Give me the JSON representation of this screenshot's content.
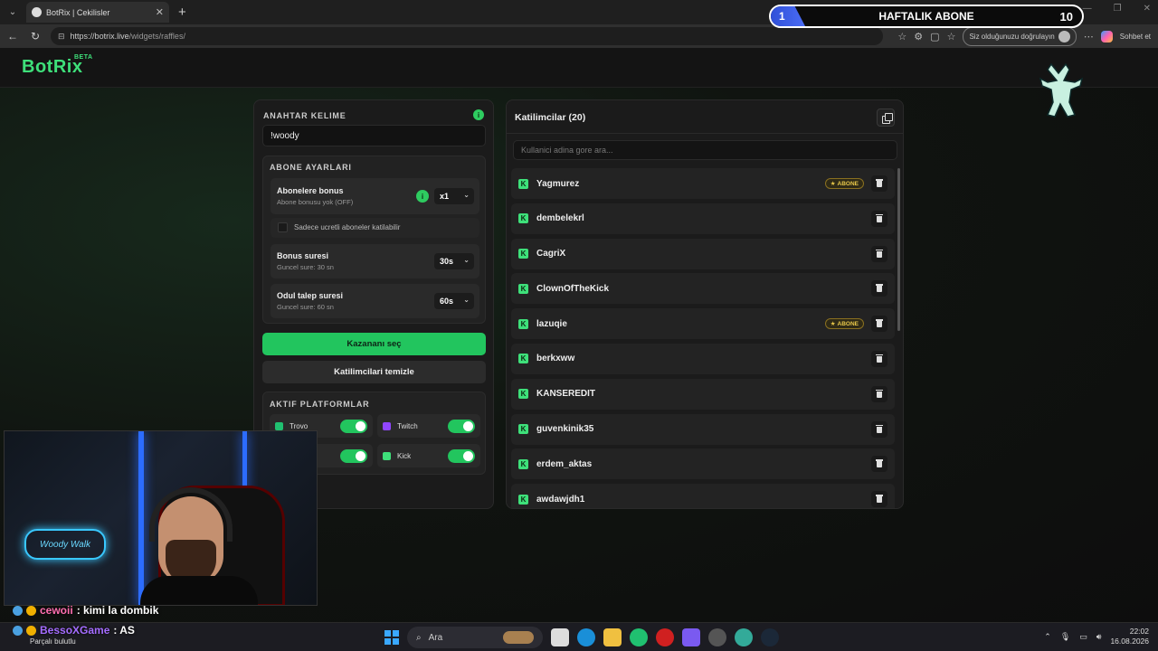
{
  "browser": {
    "tab_title": "BotRix | Cekilisler",
    "url_host": "https://botrix.live",
    "url_path": "/widgets/raffles/",
    "verify_label": "Siz olduğunuzu doğrulayın",
    "chat_label": "Sohbet et"
  },
  "sub_overlay": {
    "current": "1",
    "label": "HAFTALIK ABONE",
    "goal": "10"
  },
  "app": {
    "logo": "BotRix",
    "logo_badge": "BETA"
  },
  "settings": {
    "keyword_title": "ANAHTAR KELIME",
    "keyword_value": "!woody",
    "sub_settings_title": "ABONE AYARLARI",
    "sub_bonus": {
      "title": "Abonelere bonus",
      "subtitle": "Abone bonusu yok (OFF)",
      "value": "x1"
    },
    "paid_only_label": "Sadece ucretli aboneler katilabilir",
    "bonus_duration": {
      "title": "Bonus suresi",
      "subtitle": "Guncel sure: 30 sn",
      "value": "30s"
    },
    "claim_duration": {
      "title": "Odul talep suresi",
      "subtitle": "Guncel sure: 60 sn",
      "value": "60s"
    },
    "pick_winner_label": "Kazananı seç",
    "clear_label": "Katilimcilari temizle",
    "platforms_title": "AKTIF PLATFORMLAR",
    "platforms": [
      {
        "name": "Trovo",
        "enabled": true,
        "color": "#20c070"
      },
      {
        "name": "Twitch",
        "enabled": true,
        "color": "#9146ff"
      },
      {
        "name": "",
        "enabled": true,
        "color": "#ff3030"
      },
      {
        "name": "Kick",
        "enabled": true,
        "color": "#3ee07a"
      }
    ]
  },
  "participants": {
    "title": "Katilimcilar (20)",
    "search_placeholder": "Kullanici adina gore ara...",
    "badge_label": "ABONE",
    "list": [
      {
        "name": "Yagmurez",
        "subscriber": true
      },
      {
        "name": "dembelekrl",
        "subscriber": false
      },
      {
        "name": "CagriX",
        "subscriber": false
      },
      {
        "name": "ClownOfTheKick",
        "subscriber": false
      },
      {
        "name": "lazuqie",
        "subscriber": true
      },
      {
        "name": "berkxww",
        "subscriber": false
      },
      {
        "name": "KANSEREDIT",
        "subscriber": false
      },
      {
        "name": "guvenkinik35",
        "subscriber": false
      },
      {
        "name": "erdem_aktas",
        "subscriber": false
      },
      {
        "name": "awdawjdh1",
        "subscriber": false
      }
    ]
  },
  "webcam": {
    "sign_text": "Woody Walk"
  },
  "chat": [
    {
      "user": "cewoii",
      "message": ": kimi la dombik"
    },
    {
      "user": "BessoXGame",
      "message": ": AS",
      "sub": "Parçalı bulutlu"
    }
  ],
  "taskbar": {
    "search_label": "Ara",
    "time": "22:02",
    "date": "16.08.2026"
  }
}
